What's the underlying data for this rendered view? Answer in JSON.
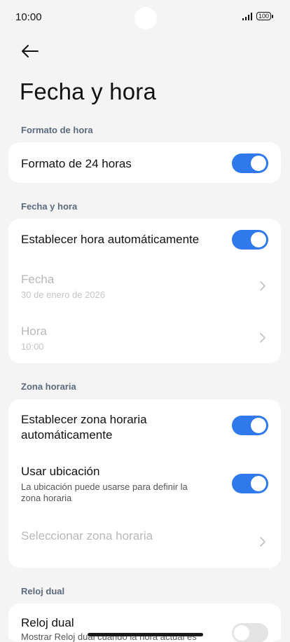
{
  "status": {
    "time": "10:00",
    "battery": "100"
  },
  "page": {
    "title": "Fecha y hora"
  },
  "sections": {
    "format_header": "Formato de hora",
    "datetime_header": "Fecha y hora",
    "timezone_header": "Zona horaria",
    "dual_header": "Reloj dual"
  },
  "format": {
    "h24_label": "Formato de 24 horas",
    "h24_on": true
  },
  "datetime": {
    "auto_label": "Establecer hora automáticamente",
    "auto_on": true,
    "date_label": "Fecha",
    "date_value": "30 de enero de 2026",
    "time_label": "Hora",
    "time_value": "10:00"
  },
  "timezone": {
    "auto_label_line1": "Establecer zona horaria",
    "auto_label_line2": "automáticamente",
    "auto_on": true,
    "location_label": "Usar ubicación",
    "location_sub_line1": "La ubicación puede usarse para definir la",
    "location_sub_line2": "zona horaria",
    "location_on": true,
    "select_label": "Seleccionar zona horaria"
  },
  "dual": {
    "label": "Reloj dual",
    "sub": "Mostrar Reloj dual cuando la hora actual es",
    "on": false
  }
}
